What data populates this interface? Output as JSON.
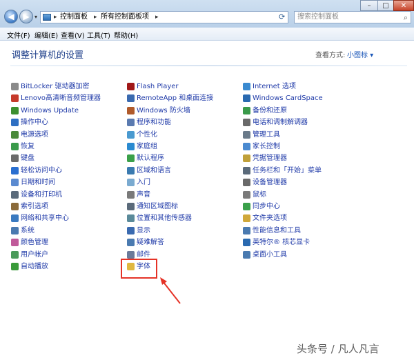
{
  "window": {
    "breadcrumb": [
      "控制面板",
      "所有控制面板项"
    ],
    "search_placeholder": "搜索控制面板",
    "controls": {
      "minimize": "–",
      "maximize": "□",
      "close": "✕"
    }
  },
  "menu": [
    "文件(F)",
    "编辑(E)",
    "查看(V)",
    "工具(T)",
    "帮助(H)"
  ],
  "header": {
    "title": "调整计算机的设置",
    "view_by_label": "查看方式:",
    "view_mode": "小图标 ▾"
  },
  "columns": [
    [
      {
        "label": "BitLocker 驱动器加密",
        "icon": "bitlocker-icon",
        "color": "#8a8a8a"
      },
      {
        "label": "Lenovo高清晰音频管理器",
        "icon": "lenovo-audio-icon",
        "color": "#c63a2a"
      },
      {
        "label": "Windows Update",
        "icon": "windows-update-icon",
        "color": "#3c8f2e"
      },
      {
        "label": "操作中心",
        "icon": "action-center-flag-icon",
        "color": "#2e6fc2"
      },
      {
        "label": "电源选项",
        "icon": "power-options-icon",
        "color": "#4a8a3a"
      },
      {
        "label": "恢复",
        "icon": "recovery-icon",
        "color": "#3a9a4a"
      },
      {
        "label": "键盘",
        "icon": "keyboard-icon",
        "color": "#6a6a6a"
      },
      {
        "label": "轻松访问中心",
        "icon": "ease-of-access-icon",
        "color": "#2a6fd0"
      },
      {
        "label": "日期和时间",
        "icon": "date-time-icon",
        "color": "#5a8ad0"
      },
      {
        "label": "设备和打印机",
        "icon": "devices-printers-icon",
        "color": "#5a6a7a"
      },
      {
        "label": "索引选项",
        "icon": "indexing-icon",
        "color": "#8a6a3a"
      },
      {
        "label": "网络和共享中心",
        "icon": "network-sharing-icon",
        "color": "#3a7ac0"
      },
      {
        "label": "系统",
        "icon": "system-icon",
        "color": "#4a7ab0"
      },
      {
        "label": "颜色管理",
        "icon": "color-management-icon",
        "color": "#c05a9a"
      },
      {
        "label": "用户帐户",
        "icon": "user-accounts-icon",
        "color": "#4a9a5a"
      },
      {
        "label": "自动播放",
        "icon": "autoplay-icon",
        "color": "#3a9a3a"
      }
    ],
    [
      {
        "label": "Flash Player",
        "icon": "flash-player-icon",
        "color": "#a01818"
      },
      {
        "label": "RemoteApp 和桌面连接",
        "icon": "remoteapp-icon",
        "color": "#3a6ab0"
      },
      {
        "label": "Windows 防火墙",
        "icon": "firewall-icon",
        "color": "#b05a2a"
      },
      {
        "label": "程序和功能",
        "icon": "programs-features-icon",
        "color": "#5a7ab0"
      },
      {
        "label": "个性化",
        "icon": "personalization-icon",
        "color": "#4a9ad0"
      },
      {
        "label": "家庭组",
        "icon": "homegroup-icon",
        "color": "#2a8ad0"
      },
      {
        "label": "默认程序",
        "icon": "default-programs-icon",
        "color": "#3aa04a"
      },
      {
        "label": "区域和语言",
        "icon": "region-language-icon",
        "color": "#3a7ab0"
      },
      {
        "label": "入门",
        "icon": "getting-started-icon",
        "color": "#7aaad0"
      },
      {
        "label": "声音",
        "icon": "sound-icon",
        "color": "#7a7a7a"
      },
      {
        "label": "通知区域图标",
        "icon": "notification-area-icon",
        "color": "#5a6a7a"
      },
      {
        "label": "位置和其他传感器",
        "icon": "location-sensors-icon",
        "color": "#5a8a9a"
      },
      {
        "label": "显示",
        "icon": "display-icon",
        "color": "#3a6ab0"
      },
      {
        "label": "疑难解答",
        "icon": "troubleshooting-icon",
        "color": "#4a7ab0"
      },
      {
        "label": "邮件",
        "icon": "mail-icon",
        "color": "#6a7a9a"
      },
      {
        "label": "字体",
        "icon": "fonts-folder-icon",
        "color": "#e0b840"
      }
    ],
    [
      {
        "label": "Internet 选项",
        "icon": "internet-options-icon",
        "color": "#3a8ad0"
      },
      {
        "label": "Windows CardSpace",
        "icon": "cardspace-icon",
        "color": "#2a6ab0"
      },
      {
        "label": "备份和还原",
        "icon": "backup-restore-icon",
        "color": "#3a9a4a"
      },
      {
        "label": "电话和调制解调器",
        "icon": "phone-modem-icon",
        "color": "#6a6a6a"
      },
      {
        "label": "管理工具",
        "icon": "admin-tools-icon",
        "color": "#6a7a8a"
      },
      {
        "label": "家长控制",
        "icon": "parental-controls-icon",
        "color": "#4a8ad0"
      },
      {
        "label": "凭据管理器",
        "icon": "credential-manager-icon",
        "color": "#c0a03a"
      },
      {
        "label": "任务栏和「开始」菜单",
        "icon": "taskbar-start-icon",
        "color": "#5a6a7a"
      },
      {
        "label": "设备管理器",
        "icon": "device-manager-icon",
        "color": "#6a6a6a"
      },
      {
        "label": "鼠标",
        "icon": "mouse-icon",
        "color": "#7a7a7a"
      },
      {
        "label": "同步中心",
        "icon": "sync-center-icon",
        "color": "#3aa04a"
      },
      {
        "label": "文件夹选项",
        "icon": "folder-options-icon",
        "color": "#d0a83a"
      },
      {
        "label": "性能信息和工具",
        "icon": "performance-icon",
        "color": "#4a7ab0"
      },
      {
        "label": "英特尔® 核芯显卡",
        "icon": "intel-graphics-icon",
        "color": "#2a6ab0"
      },
      {
        "label": "桌面小工具",
        "icon": "desktop-gadgets-icon",
        "color": "#4a7ab0"
      }
    ]
  ],
  "watermark": "头条号 / 凡人凡言",
  "accent_color": "#e53226"
}
